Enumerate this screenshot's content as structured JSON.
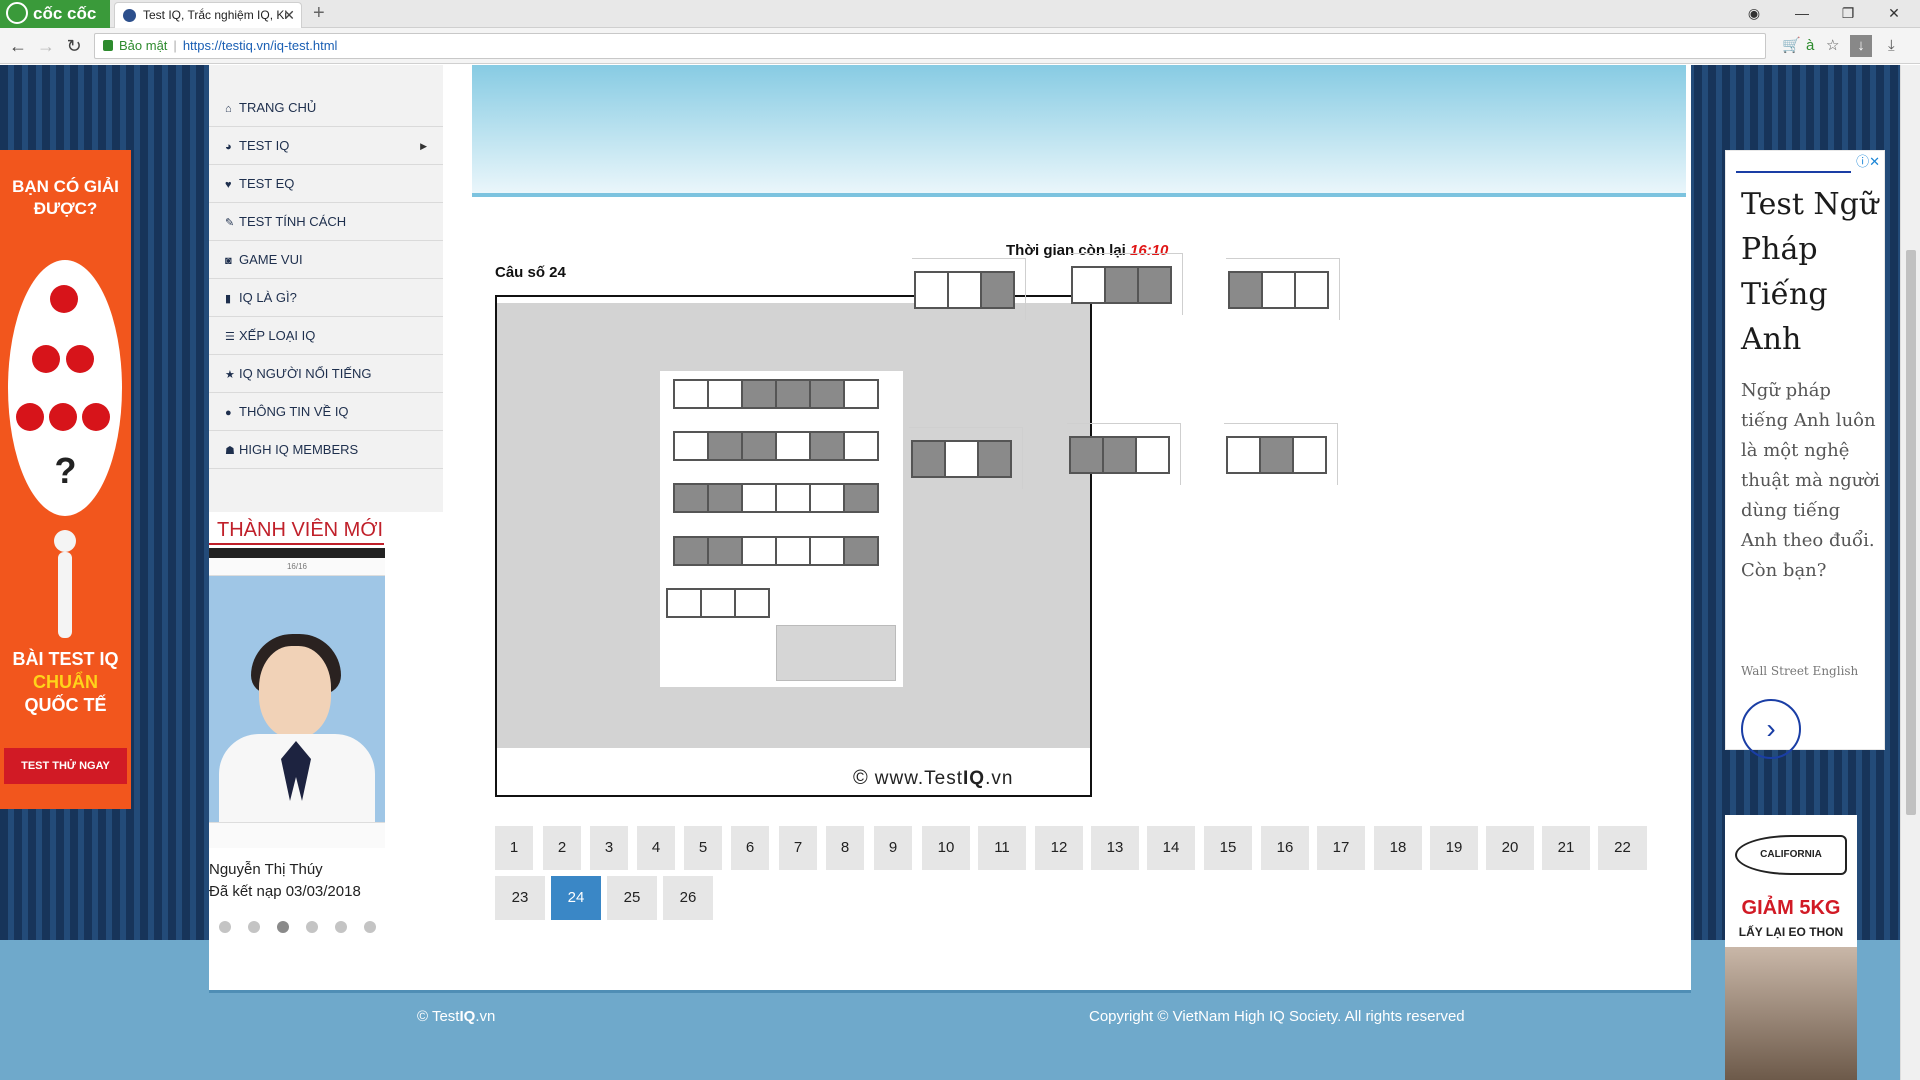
{
  "browser": {
    "brand": "cốc cốc",
    "tab_title": "Test IQ, Trắc nghiệm IQ, Ki",
    "new_tab": "+",
    "security_label": "Bảo mật",
    "url": "https://testiq.vn/iq-test.html"
  },
  "menu": {
    "items": [
      {
        "label": "TRANG CHỦ",
        "icon": "home-icon"
      },
      {
        "label": "TEST IQ",
        "icon": "brain-icon"
      },
      {
        "label": "TEST EQ",
        "icon": "heart-icon"
      },
      {
        "label": "TEST TÍNH CÁCH",
        "icon": "chat-icon"
      },
      {
        "label": "GAME VUI",
        "icon": "gamepad-icon"
      },
      {
        "label": "IQ LÀ GÌ?",
        "icon": "book-icon"
      },
      {
        "label": "XẾP LOẠI IQ",
        "icon": "list-icon"
      },
      {
        "label": "IQ NGƯỜI NỔI TIẾNG",
        "icon": "star-icon"
      },
      {
        "label": "THÔNG TIN VỀ IQ",
        "icon": "info-icon"
      },
      {
        "label": "HIGH IQ MEMBERS",
        "icon": "users-icon"
      }
    ]
  },
  "new_members": {
    "title": "THÀNH VIÊN MỚI",
    "phone_header": "16/16",
    "name": "Nguyễn Thị Thúy",
    "joined": "Đã kết nạp 03/03/2018",
    "slides": 6,
    "active_slide": 3
  },
  "quiz": {
    "timer_label": "Thời gian còn lại",
    "timer_value": "16:10",
    "question_label": "Câu số 24",
    "watermark_pre": "www.Test",
    "watermark_bold": "IQ",
    "watermark_post": ".vn",
    "question_rows": [
      [
        0,
        0,
        1,
        1,
        1,
        0
      ],
      [
        0,
        1,
        1,
        0,
        1,
        0
      ],
      [
        1,
        1,
        0,
        0,
        0,
        1
      ],
      [
        1,
        1,
        0,
        0,
        0,
        1
      ],
      [
        0,
        0,
        0
      ]
    ],
    "options": [
      [
        0,
        0,
        1
      ],
      [
        0,
        1,
        1
      ],
      [
        1,
        0,
        0
      ],
      [
        1,
        0,
        1
      ],
      [
        1,
        1,
        0
      ],
      [
        0,
        1,
        0
      ]
    ]
  },
  "pagination": {
    "pages": [
      "1",
      "2",
      "3",
      "4",
      "5",
      "6",
      "7",
      "8",
      "9",
      "10",
      "11",
      "12",
      "13",
      "14",
      "15",
      "16",
      "17",
      "18",
      "19",
      "20",
      "21",
      "22",
      "23",
      "24",
      "25",
      "26"
    ],
    "current": "24"
  },
  "ad_left": {
    "headline": "BẠN CÓ GIẢI ĐƯỢC?",
    "question_mark": "?",
    "tag_white": "BÀI TEST IQ",
    "tag_yellow": "CHUẨN",
    "tag_white2": "QUỐC TẾ",
    "button": "TEST THỬ NGAY"
  },
  "ad_right": {
    "title": "Test Ngữ Pháp Tiếng Anh",
    "text": "Ngữ pháp tiếng Anh luôn là một nghệ thuật mà người dùng tiếng Anh theo đuổi. Còn bạn?",
    "sponsor": "Wall Street English",
    "info_icon": "ⓘ✕"
  },
  "ad_right2": {
    "logo": "CALIFORNIA",
    "sale": "GIẢM 5KG",
    "sub": "LẤY LẠI EO THON"
  },
  "footer": {
    "left_pre": "© Test",
    "left_bold": "IQ",
    "left_post": ".vn",
    "right": "Copyright © VietNam High IQ Society. All rights reserved"
  },
  "colors": {
    "accent": "#3a87c6",
    "timer": "#e01515",
    "members_title": "#c0202a",
    "page_bg": "#1d3b63",
    "footer_bg": "#6fa9cb"
  }
}
